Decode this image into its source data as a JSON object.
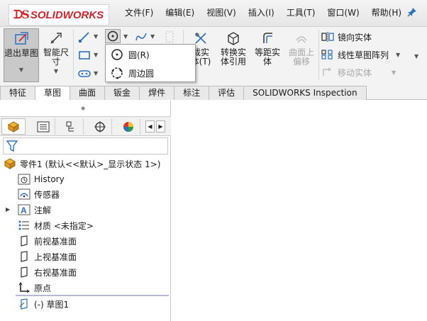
{
  "app": {
    "logo_ds": "ᗪS",
    "logo_word": "SOLIDWORKS"
  },
  "menu": {
    "items": [
      "文件(F)",
      "编辑(E)",
      "视图(V)",
      "插入(I)",
      "工具(T)",
      "窗口(W)",
      "帮助(H)"
    ]
  },
  "ribbon": {
    "exit_sketch": "退出草图",
    "smart_dim_line1": "智能尺",
    "smart_dim_line2": "寸",
    "trim_part": "裁实",
    "trim_part2": "体(T)",
    "convert_line1": "转换实",
    "convert_line2": "体引用",
    "offset_line1": "等距实",
    "offset_line2": "体",
    "surface_offset_line1": "曲面上",
    "surface_offset_line2": "偏移",
    "mirror": "镜向实体",
    "linear_pattern": "线性草图阵列",
    "move": "移动实体"
  },
  "dropdown": {
    "items": [
      "圆(R)",
      "周边圆"
    ]
  },
  "tabs": {
    "items": [
      "特征",
      "草图",
      "曲面",
      "钣金",
      "焊件",
      "标注",
      "评估",
      "SOLIDWORKS Inspection"
    ],
    "active": "草图"
  },
  "tree": {
    "root": "零件1  (默认<<默认>_显示状态 1>)",
    "items": [
      "History",
      "传感器",
      "注解",
      "材质 <未指定>",
      "前视基准面",
      "上视基准面",
      "右视基准面",
      "原点",
      "(-) 草图1"
    ]
  },
  "colors": {
    "brand": "#d2232a",
    "accent": "#2d6fc2"
  }
}
